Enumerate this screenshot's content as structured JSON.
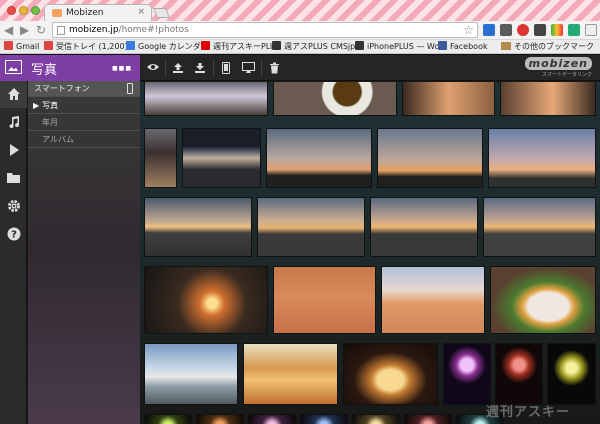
{
  "browser": {
    "tab_title": "Mobizen",
    "tab_close": "×",
    "url_host": "mobizen.jp",
    "url_path": "/home#!photos",
    "bookmarks": [
      {
        "label": "Gmail",
        "color": "#d44"
      },
      {
        "label": "受信トレイ (1,200)",
        "color": "#d44"
      },
      {
        "label": "Google カレンダー",
        "color": "#3a7be0"
      },
      {
        "label": "週刊アスキーPLUS",
        "color": "#d00"
      },
      {
        "label": "週アスPLUS CMSjp",
        "color": "#333"
      },
      {
        "label": "iPhonePLUS — Word",
        "color": "#333"
      },
      {
        "label": "Facebook",
        "color": "#3b5998"
      }
    ],
    "other_bookmarks": "その他のブックマーク"
  },
  "app": {
    "section_title": "写真",
    "device_label": "スマートフォン",
    "nav": [
      {
        "label": "写真",
        "selected": true
      },
      {
        "label": "年月",
        "selected": false
      },
      {
        "label": "アルバム",
        "selected": false
      }
    ],
    "logo_text": "mobizen",
    "logo_sub": "スマートデータリンク",
    "rail_icons": [
      "home-icon",
      "music-icon",
      "video-icon",
      "folder-icon",
      "settings-icon",
      "help-icon"
    ],
    "toolbar_icons": [
      "eye-icon",
      "upload-icon",
      "download-icon",
      "phone-icon",
      "monitor-icon",
      "trash-icon"
    ]
  },
  "watermark": "週刊アスキー"
}
